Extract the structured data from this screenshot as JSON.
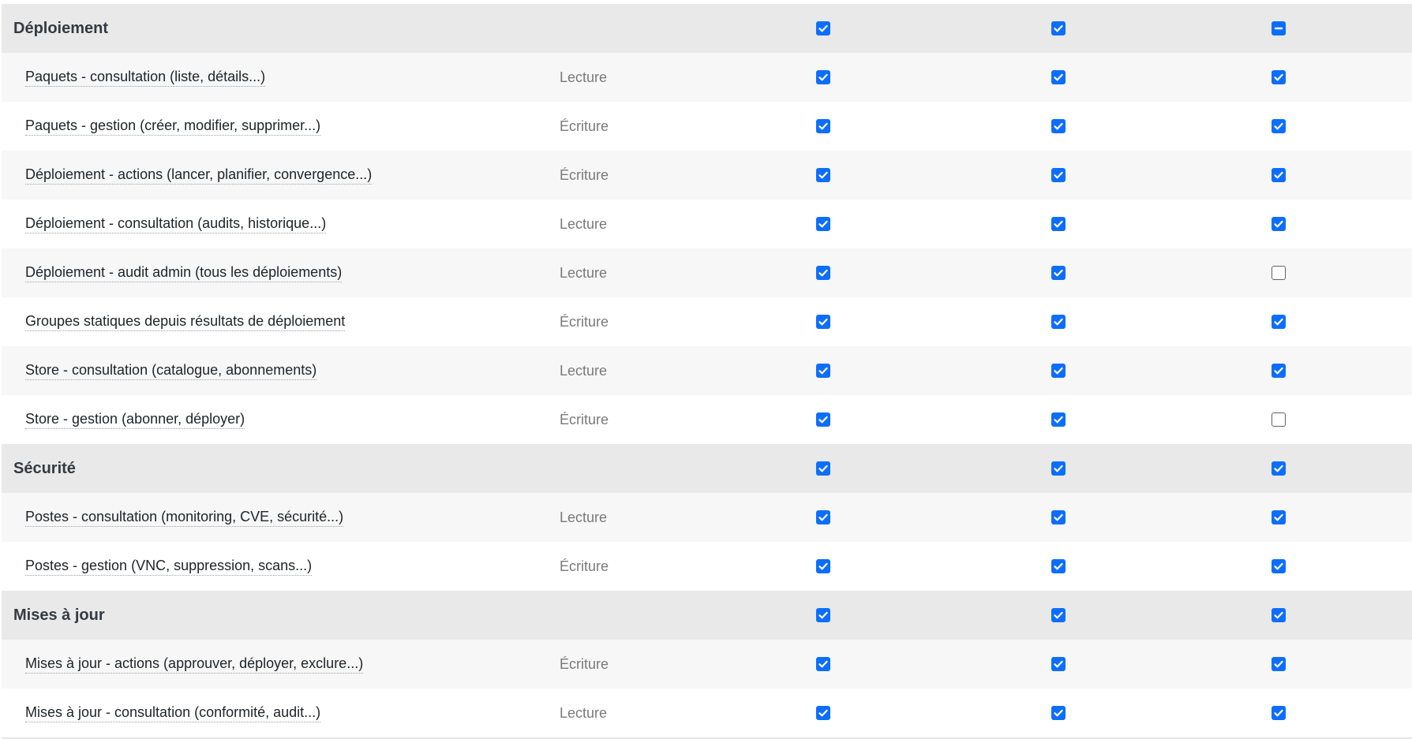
{
  "colors": {
    "accent": "#0d6efd",
    "group_bg": "#e9e9e9",
    "row_alt_bg": "#f7f7f7"
  },
  "icons": {
    "checked": "checkbox-checked-icon",
    "mixed": "checkbox-indeterminate-icon",
    "unchecked": "checkbox-empty-icon"
  },
  "rows": [
    {
      "kind": "group",
      "label": "Déploiement",
      "type": "",
      "checks": [
        "checked",
        "checked",
        "mixed"
      ]
    },
    {
      "kind": "perm",
      "label": "Paquets - consultation (liste, détails...)",
      "type": "Lecture",
      "checks": [
        "checked",
        "checked",
        "checked"
      ]
    },
    {
      "kind": "perm",
      "label": "Paquets - gestion (créer, modifier, supprimer...)",
      "type": "Écriture",
      "checks": [
        "checked",
        "checked",
        "checked"
      ]
    },
    {
      "kind": "perm",
      "label": "Déploiement - actions (lancer, planifier, convergence...)",
      "type": "Écriture",
      "checks": [
        "checked",
        "checked",
        "checked"
      ]
    },
    {
      "kind": "perm",
      "label": "Déploiement - consultation (audits, historique...)",
      "type": "Lecture",
      "checks": [
        "checked",
        "checked",
        "checked"
      ]
    },
    {
      "kind": "perm",
      "label": "Déploiement - audit admin (tous les déploiements)",
      "type": "Lecture",
      "checks": [
        "checked",
        "checked",
        "unchecked"
      ]
    },
    {
      "kind": "perm",
      "label": "Groupes statiques depuis résultats de déploiement",
      "type": "Écriture",
      "checks": [
        "checked",
        "checked",
        "checked"
      ]
    },
    {
      "kind": "perm",
      "label": "Store - consultation (catalogue, abonnements)",
      "type": "Lecture",
      "checks": [
        "checked",
        "checked",
        "checked"
      ]
    },
    {
      "kind": "perm",
      "label": "Store - gestion (abonner, déployer)",
      "type": "Écriture",
      "checks": [
        "checked",
        "checked",
        "unchecked"
      ]
    },
    {
      "kind": "group",
      "label": "Sécurité",
      "type": "",
      "checks": [
        "checked",
        "checked",
        "checked"
      ]
    },
    {
      "kind": "perm",
      "label": "Postes - consultation (monitoring, CVE, sécurité...)",
      "type": "Lecture",
      "checks": [
        "checked",
        "checked",
        "checked"
      ]
    },
    {
      "kind": "perm",
      "label": "Postes - gestion (VNC, suppression, scans...)",
      "type": "Écriture",
      "checks": [
        "checked",
        "checked",
        "checked"
      ]
    },
    {
      "kind": "group",
      "label": "Mises à jour",
      "type": "",
      "checks": [
        "checked",
        "checked",
        "checked"
      ]
    },
    {
      "kind": "perm",
      "label": "Mises à jour - actions (approuver, déployer, exclure...)",
      "type": "Écriture",
      "checks": [
        "checked",
        "checked",
        "checked"
      ]
    },
    {
      "kind": "perm",
      "label": "Mises à jour - consultation (conformité, audit...)",
      "type": "Lecture",
      "checks": [
        "checked",
        "checked",
        "checked"
      ]
    }
  ]
}
